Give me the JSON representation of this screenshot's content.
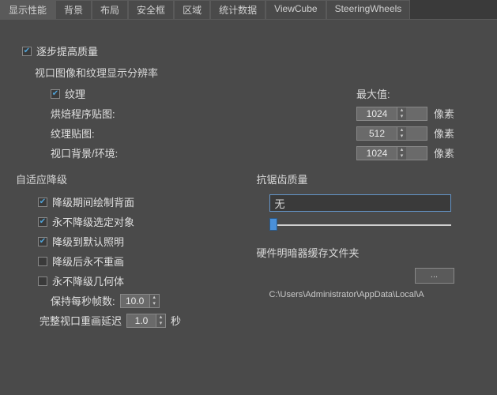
{
  "tabs": [
    "显示性能",
    "背景",
    "布局",
    "安全框",
    "区域",
    "统计数据",
    "ViewCube",
    "SteeringWheels"
  ],
  "activeTab": 0,
  "progressive": {
    "checkbox_label": "逐步提高质量",
    "section_title": "视口图像和纹理显示分辨率",
    "texture_label": "纹理",
    "max_label": "最大值:",
    "rows": [
      {
        "label": "烘焙程序贴图:",
        "value": "1024",
        "unit": "像素"
      },
      {
        "label": "纹理贴图:",
        "value": "512",
        "unit": "像素"
      },
      {
        "label": "视口背景/环境:",
        "value": "1024",
        "unit": "像素"
      }
    ]
  },
  "degrade": {
    "title": "自适应降级",
    "items": [
      {
        "label": "降级期间绘制背面",
        "checked": true
      },
      {
        "label": "永不降级选定对象",
        "checked": true
      },
      {
        "label": "降级到默认照明",
        "checked": true
      },
      {
        "label": "降级后永不重画",
        "checked": false
      },
      {
        "label": "永不降级几何体",
        "checked": false
      }
    ],
    "fps_label": "保持每秒帧数:",
    "fps_value": "10.0",
    "redraw_label": "完整视口重画延迟",
    "redraw_value": "1.0",
    "redraw_unit": "秒"
  },
  "aa": {
    "title": "抗锯齿质量",
    "value": "无"
  },
  "cache": {
    "title": "硬件明暗器缓存文件夹",
    "browse": "...",
    "path": "C:\\Users\\Administrator\\AppData\\Local\\A"
  }
}
